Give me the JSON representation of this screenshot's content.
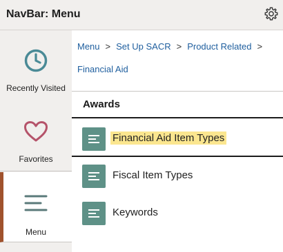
{
  "header": {
    "title": "NavBar: Menu",
    "icon": "gear-icon"
  },
  "sidebar": {
    "items": [
      {
        "label": "Recently Visited",
        "icon": "clock-icon",
        "color": "#4a8a96"
      },
      {
        "label": "Favorites",
        "icon": "heart-icon",
        "color": "#b5536a"
      },
      {
        "label": "Menu",
        "icon": "menu-lines-icon",
        "color": "#5a7a7a",
        "active": true
      }
    ]
  },
  "breadcrumb": {
    "items": [
      "Menu",
      "Set Up SACR",
      "Product Related",
      "Financial Aid"
    ],
    "separator": ">"
  },
  "section": {
    "title": "Awards"
  },
  "list": {
    "items": [
      {
        "label": "Financial Aid Item Types",
        "highlighted": true
      },
      {
        "label": "Fiscal Item Types"
      },
      {
        "label": "Keywords"
      }
    ]
  },
  "colors": {
    "accent": "#a0522d",
    "link": "#1e5e9e",
    "icon_tile": "#5e9187",
    "highlight": "#fbe68f"
  }
}
